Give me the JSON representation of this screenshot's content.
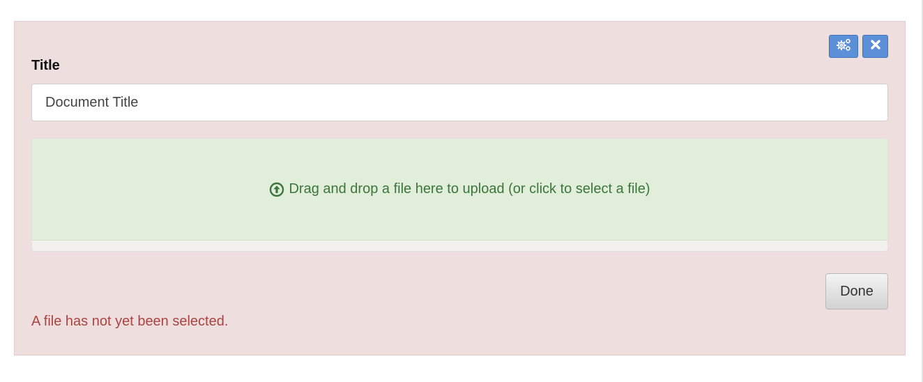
{
  "toolbar": {
    "settings_icon": "gears-icon",
    "close_icon": "close-icon"
  },
  "form": {
    "title_label": "Title",
    "title_value": "Document Title"
  },
  "dropzone": {
    "icon": "upload-circle-icon",
    "text": "Drag and drop a file here to upload (or click to select a file)"
  },
  "actions": {
    "done_label": "Done"
  },
  "status": {
    "error_message": "A file has not yet been selected."
  },
  "colors": {
    "panel_bg": "#efdede",
    "button_blue": "#5b8fd8",
    "dropzone_bg": "#e1eed9",
    "dropzone_text": "#3c763d",
    "error_text": "#a94442"
  }
}
